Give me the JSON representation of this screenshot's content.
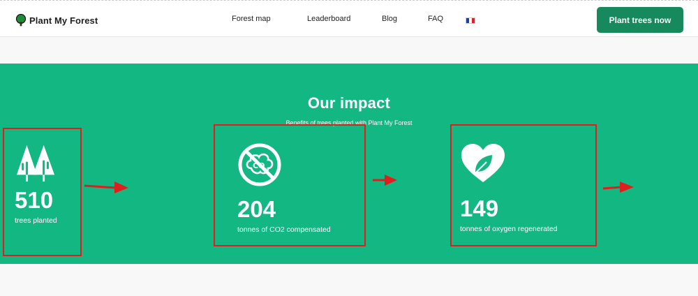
{
  "header": {
    "logo_text": "Plant My Forest",
    "nav": [
      {
        "label": "Forest map"
      },
      {
        "label": "Leaderboard"
      },
      {
        "label": "Blog"
      },
      {
        "label": "FAQ"
      }
    ],
    "language_flag": "france-flag-icon",
    "cta_label": "Plant trees now"
  },
  "impact": {
    "title": "Our impact",
    "subtitle": "Benefits of trees planted with Plant My Forest",
    "stats": [
      {
        "value": "510",
        "label": "trees planted",
        "icon": "trees-icon"
      },
      {
        "value": "204",
        "label": "tonnes of CO2 compensated",
        "icon": "no-co2-icon"
      },
      {
        "value": "149",
        "label": "tonnes of oxygen regenerated",
        "icon": "heart-leaf-icon"
      }
    ]
  },
  "colors": {
    "brand_green": "#13b781",
    "button_green": "#168a5c",
    "annotation_red": "#e01e1e"
  }
}
